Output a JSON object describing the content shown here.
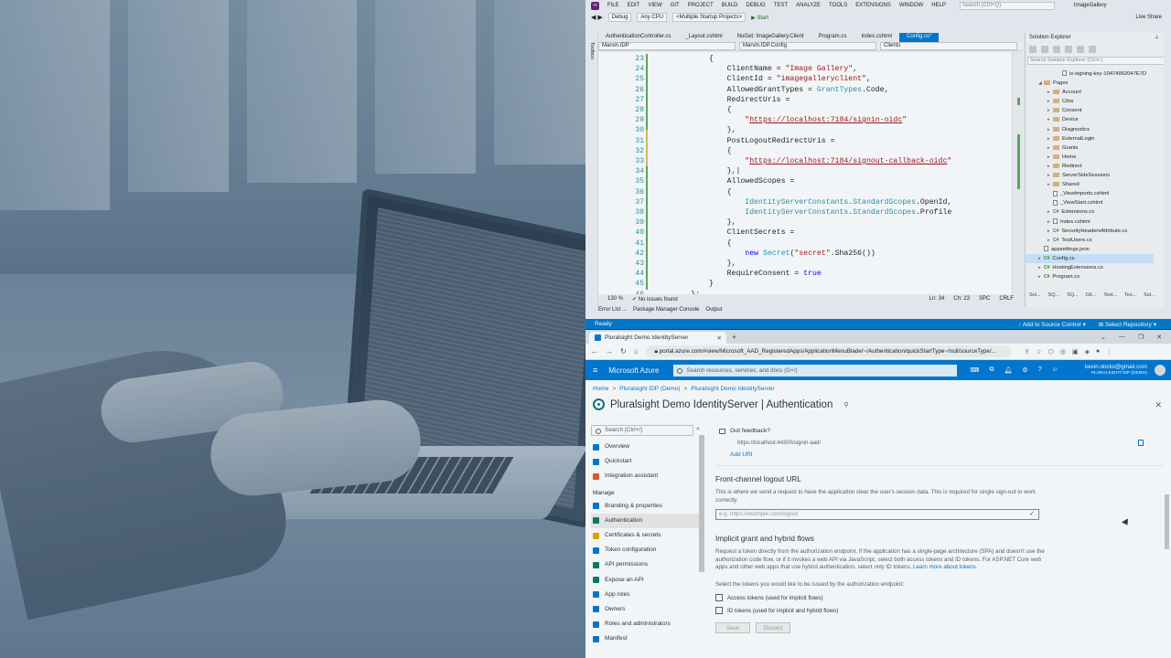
{
  "vs": {
    "menu": [
      "FILE",
      "EDIT",
      "VIEW",
      "GIT",
      "PROJECT",
      "BUILD",
      "DEBUG",
      "TEST",
      "ANALYZE",
      "TOOLS",
      "EXTENSIONS",
      "WINDOW",
      "HELP"
    ],
    "search_placeholder": "Search (Ctrl+Q)",
    "solution_title": "ImageGallery",
    "toolbar": {
      "config": "Debug",
      "platform": "Any CPU",
      "startup": "<Multiple Startup Projects>",
      "start": "▶ Start",
      "live_share": "Live Share"
    },
    "tabs": [
      "AuthenticationController.cs",
      "_Layout.cshtml",
      "NuGet: ImageGallery.Client",
      "Program.cs",
      "Index.cshtml",
      "Config.cs*"
    ],
    "active_tab_index": 5,
    "nav": {
      "project": "Marvin.IDP",
      "type": "Marvin.IDP.Config",
      "member": "Clients"
    },
    "side_strip": "Toolbox",
    "code_lines": [
      {
        "n": "23",
        "code": "            {"
      },
      {
        "n": "24",
        "code": "                ClientName = \"Image Gallery\","
      },
      {
        "n": "25",
        "code": "                ClientId = \"imagegalleryclient\","
      },
      {
        "n": "26",
        "code": "                AllowedGrantTypes = GrantTypes.Code,"
      },
      {
        "n": "27",
        "code": "                RedirectUris ="
      },
      {
        "n": "28",
        "code": "                {"
      },
      {
        "n": "29",
        "code": "                    \"https://localhost:7184/signin-oidc\""
      },
      {
        "n": "30",
        "code": "                },"
      },
      {
        "n": "31",
        "code": "                PostLogoutRedirectUris ="
      },
      {
        "n": "32",
        "code": "                {"
      },
      {
        "n": "33",
        "code": "                    \"https://localhost:7184/signout-callback-oidc\""
      },
      {
        "n": "34",
        "code": "                },|"
      },
      {
        "n": "35",
        "code": "                AllowedScopes ="
      },
      {
        "n": "36",
        "code": "                {"
      },
      {
        "n": "37",
        "code": "                    IdentityServerConstants.StandardScopes.OpenId,"
      },
      {
        "n": "38",
        "code": "                    IdentityServerConstants.StandardScopes.Profile"
      },
      {
        "n": "39",
        "code": "                },"
      },
      {
        "n": "40",
        "code": "                ClientSecrets ="
      },
      {
        "n": "41",
        "code": "                {"
      },
      {
        "n": "42",
        "code": "                    new Secret(\"secret\".Sha256())"
      },
      {
        "n": "43",
        "code": "                },"
      },
      {
        "n": "44",
        "code": "                RequireConsent = true"
      },
      {
        "n": "45",
        "code": "            }"
      },
      {
        "n": "46",
        "code": "        };"
      }
    ],
    "editor_status": {
      "zoom": "130 %",
      "issues": "No issues found",
      "ln": "Ln: 34",
      "ch": "Ch: 23",
      "spc": "SPC",
      "crlf": "CRLF"
    },
    "bottom_tabs": [
      "Error List ...",
      "Package Manager Console",
      "Output"
    ],
    "statusbar": {
      "ready": "Ready",
      "add_source": "↑ Add to Source Control ▾",
      "select_repo": "⊞ Select Repository ▾"
    },
    "solution_explorer": {
      "title": "Solution Explorer",
      "search": "Search Solution Explorer (Ctrl+;)",
      "items": [
        {
          "label": "is-signing-key-10474962047E7D",
          "kind": "file",
          "indent": 3,
          "exp": ""
        },
        {
          "label": "Pages",
          "kind": "folder",
          "indent": 1,
          "exp": "◢"
        },
        {
          "label": "Account",
          "kind": "folder",
          "indent": 2,
          "exp": "▸"
        },
        {
          "label": "Ciba",
          "kind": "folder",
          "indent": 2,
          "exp": "▸"
        },
        {
          "label": "Consent",
          "kind": "folder",
          "indent": 2,
          "exp": "▸"
        },
        {
          "label": "Device",
          "kind": "folder",
          "indent": 2,
          "exp": "▸"
        },
        {
          "label": "Diagnostics",
          "kind": "folder",
          "indent": 2,
          "exp": "▸"
        },
        {
          "label": "ExternalLogin",
          "kind": "folder",
          "indent": 2,
          "exp": "▸"
        },
        {
          "label": "Grants",
          "kind": "folder",
          "indent": 2,
          "exp": "▸"
        },
        {
          "label": "Home",
          "kind": "folder",
          "indent": 2,
          "exp": "▸"
        },
        {
          "label": "Redirect",
          "kind": "folder",
          "indent": 2,
          "exp": "▸"
        },
        {
          "label": "ServerSideSessions",
          "kind": "folder",
          "indent": 2,
          "exp": "▸"
        },
        {
          "label": "Shared",
          "kind": "folder",
          "indent": 2,
          "exp": "▸"
        },
        {
          "label": "_ViewImports.cshtml",
          "kind": "file",
          "indent": 2,
          "exp": ""
        },
        {
          "label": "_ViewStart.cshtml",
          "kind": "file",
          "indent": 2,
          "exp": ""
        },
        {
          "label": "Extensions.cs",
          "kind": "cs",
          "indent": 2,
          "exp": "▸"
        },
        {
          "label": "Index.cshtml",
          "kind": "file",
          "indent": 2,
          "exp": "▸"
        },
        {
          "label": "SecurityHeadersAttribute.cs",
          "kind": "cs",
          "indent": 2,
          "exp": "▸"
        },
        {
          "label": "TestUsers.cs",
          "kind": "cs",
          "indent": 2,
          "exp": "▸"
        },
        {
          "label": "appsettings.json",
          "kind": "file",
          "indent": 1,
          "exp": ""
        },
        {
          "label": "Config.cs",
          "kind": "cs",
          "indent": 1,
          "exp": "▸",
          "selected": true
        },
        {
          "label": "HostingExtensions.cs",
          "kind": "cs",
          "indent": 1,
          "exp": "▸"
        },
        {
          "label": "Program.cs",
          "kind": "cs",
          "indent": 1,
          "exp": "▸"
        }
      ],
      "bottom_tabs": [
        "Sol...",
        "SQ...",
        "SQ...",
        "Git...",
        "Test...",
        "Tes...",
        "Sol..."
      ]
    }
  },
  "browser": {
    "tab_title": "Pluralsight Demo IdentityServer",
    "url_host": "portal.azure.com",
    "url_path": "/#view/Microsoft_AAD_RegisteredApps/ApplicationMenuBlade/~/Authentication/quickStartType~/null/sourceType/...",
    "azure": {
      "brand": "Microsoft Azure",
      "search_placeholder": "Search resources, services, and docs (G+/)",
      "user_email": "kevin.dockx@gmail.com",
      "user_tenant": "PLURALSIGHT IDP (DEMO)"
    },
    "breadcrumb": [
      "Home",
      "Pluralsight IDP (Demo)",
      "Pluralsight Demo IdentityServer"
    ],
    "page_title": "Pluralsight Demo IdentityServer | Authentication",
    "left_nav": {
      "search_placeholder": "Search (Ctrl+/)",
      "items_top": [
        {
          "label": "Overview",
          "color": "#0078d4"
        },
        {
          "label": "Quickstart",
          "color": "#0078d4"
        },
        {
          "label": "Integration assistant",
          "color": "#e05a2a"
        }
      ],
      "section": "Manage",
      "items_manage": [
        {
          "label": "Branding & properties",
          "color": "#0078d4"
        },
        {
          "label": "Authentication",
          "color": "#0a7a6a",
          "selected": true
        },
        {
          "label": "Certificates & secrets",
          "color": "#e0a800"
        },
        {
          "label": "Token configuration",
          "color": "#0078d4"
        },
        {
          "label": "API permissions",
          "color": "#0a7a6a"
        },
        {
          "label": "Expose an API",
          "color": "#0a7a6a"
        },
        {
          "label": "App roles",
          "color": "#0078d4"
        },
        {
          "label": "Owners",
          "color": "#0078d4"
        },
        {
          "label": "Roles and administrators",
          "color": "#0078d4"
        },
        {
          "label": "Manifest",
          "color": "#0078d4"
        }
      ]
    },
    "content": {
      "feedback": "Got feedback?",
      "redirect_value": "https://localhost:44300/signin-aad/",
      "add_uri": "Add URI",
      "logout_heading": "Front-channel logout URL",
      "logout_desc": "This is where we send a request to have the application clear the user's session data. This is required for single sign-out to work correctly.",
      "logout_placeholder": "e.g. https://example.com/logout",
      "implicit_heading": "Implicit grant and hybrid flows",
      "implicit_desc": "Request a token directly from the authorization endpoint. If the application has a single-page architecture (SPA) and doesn't use the authorization code flow, or if it invokes a web API via JavaScript, select both access tokens and ID tokens. For ASP.NET Core web apps and other web apps that use hybrid authentication, select only ID tokens.",
      "learn_more": "Learn more about tokens.",
      "tokens_prompt": "Select the tokens you would like to be issued by the authorization endpoint:",
      "access_tokens": "Access tokens (used for implicit flows)",
      "id_tokens": "ID tokens (used for implicit and hybrid flows)",
      "save": "Save",
      "discard": "Discard"
    }
  }
}
